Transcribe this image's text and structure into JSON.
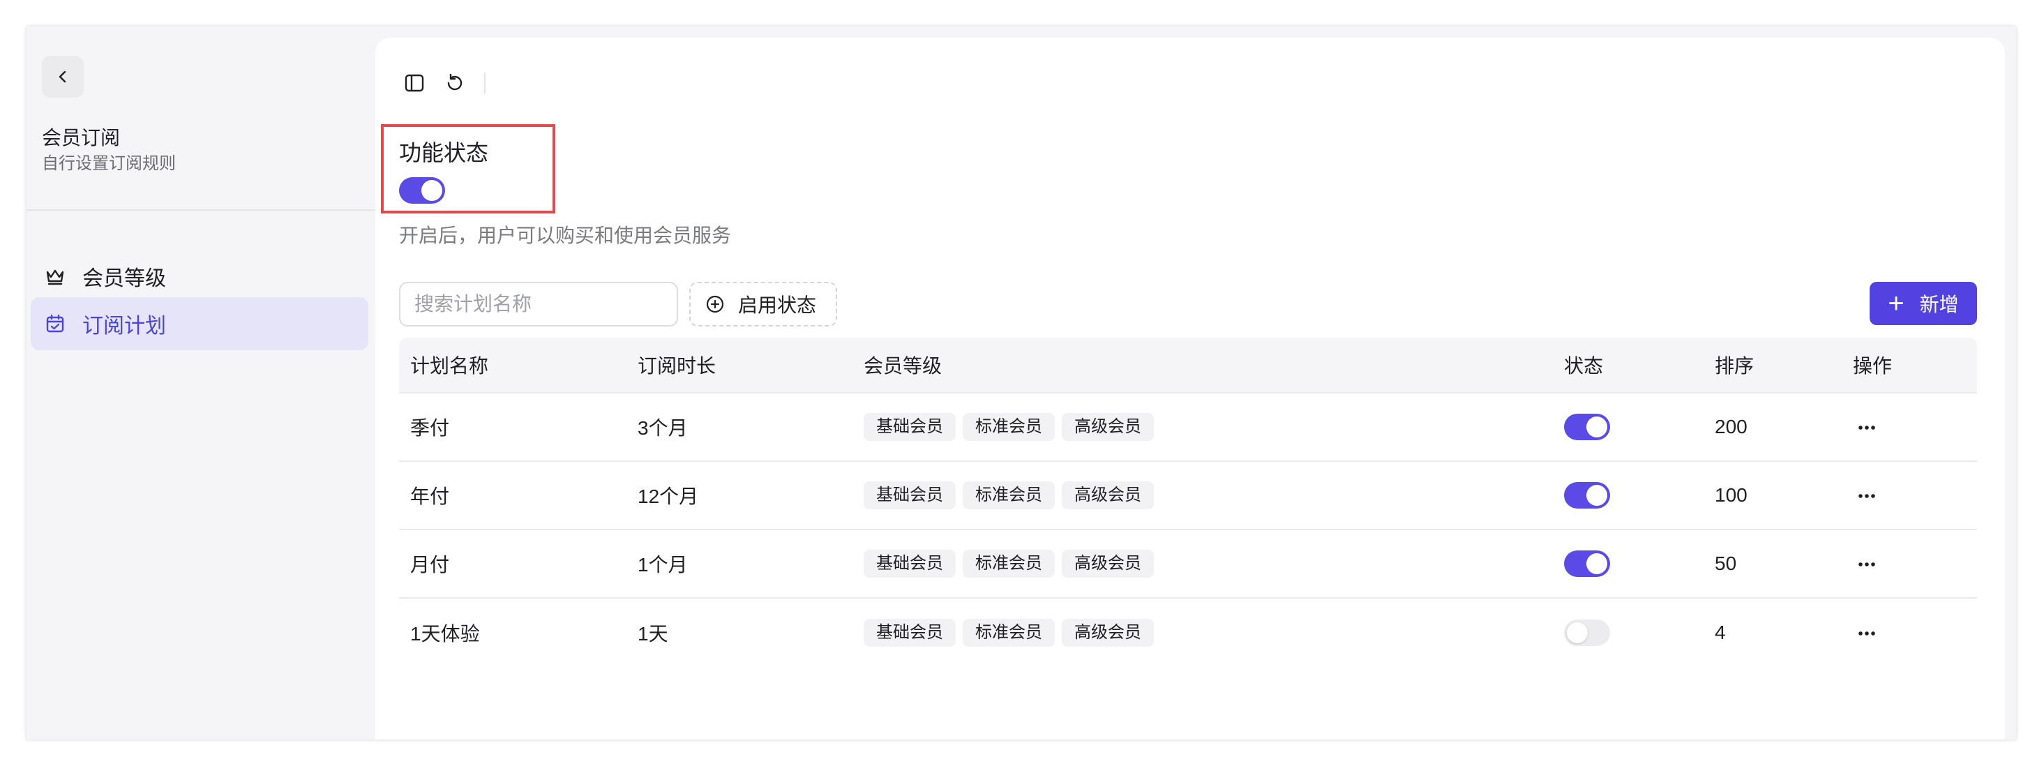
{
  "sidebar": {
    "title": "会员订阅",
    "subtitle": "自行设置订阅规则",
    "items": [
      {
        "label": "会员等级",
        "icon": "crown-icon",
        "active": false
      },
      {
        "label": "订阅计划",
        "icon": "calendar-check-icon",
        "active": true
      }
    ]
  },
  "feature": {
    "title": "功能状态",
    "enabled": true,
    "description": "开启后，用户可以购买和使用会员服务"
  },
  "filters": {
    "search_placeholder": "搜索计划名称",
    "status_filter_label": "启用状态"
  },
  "actions": {
    "add_label": "新增"
  },
  "table": {
    "columns": [
      "计划名称",
      "订阅时长",
      "会员等级",
      "状态",
      "排序",
      "操作"
    ],
    "rows": [
      {
        "name": "季付",
        "duration": "3个月",
        "levels": [
          "基础会员",
          "标准会员",
          "高级会员"
        ],
        "enabled": true,
        "sort": "200"
      },
      {
        "name": "年付",
        "duration": "12个月",
        "levels": [
          "基础会员",
          "标准会员",
          "高级会员"
        ],
        "enabled": true,
        "sort": "100"
      },
      {
        "name": "月付",
        "duration": "1个月",
        "levels": [
          "基础会员",
          "标准会员",
          "高级会员"
        ],
        "enabled": true,
        "sort": "50"
      },
      {
        "name": "1天体验",
        "duration": "1天",
        "levels": [
          "基础会员",
          "标准会员",
          "高级会员"
        ],
        "enabled": false,
        "sort": "4"
      }
    ]
  },
  "colors": {
    "accent": "#5243e0",
    "switch_on": "#5b4be6",
    "highlight_border": "#e5484d",
    "active_nav_bg": "#e6e4f8"
  }
}
